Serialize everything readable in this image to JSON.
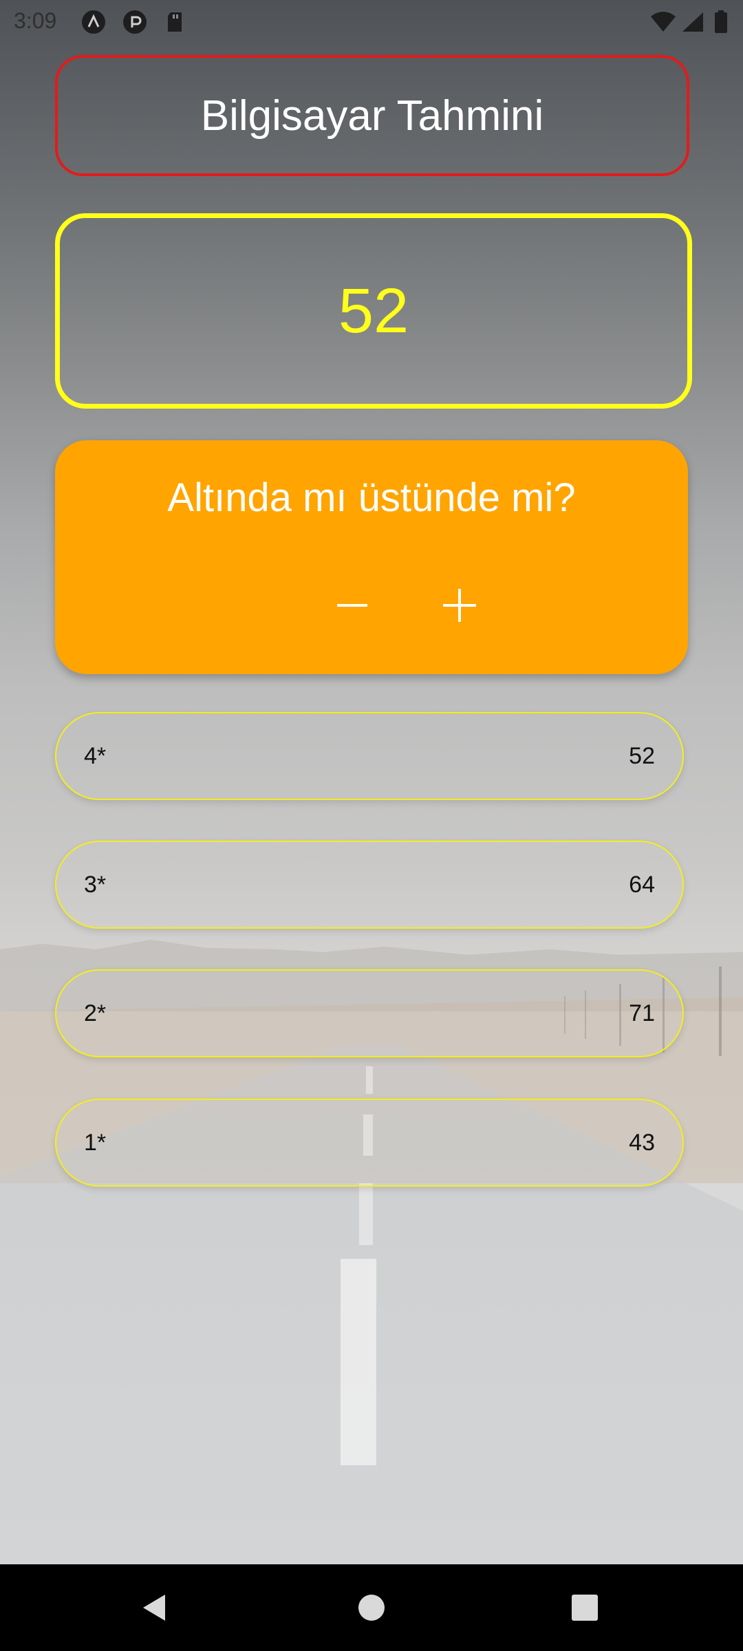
{
  "status_bar": {
    "time": "3:09",
    "icons": [
      "a-icon",
      "p-icon",
      "sd-card-icon",
      "wifi-icon",
      "signal-icon",
      "battery-icon"
    ]
  },
  "title": "Bilgisayar Tahmini",
  "guess_value": "52",
  "question": {
    "text": "Altında mı üstünde mi?",
    "minus_icon": "minus-icon",
    "plus_icon": "plus-icon"
  },
  "history": [
    {
      "label": "4*",
      "value": "52"
    },
    {
      "label": "3*",
      "value": "64"
    },
    {
      "label": "2*",
      "value": "71"
    },
    {
      "label": "1*",
      "value": "43"
    }
  ],
  "colors": {
    "title_border": "#e31b1b",
    "guess_accent": "#ffff1a",
    "question_bg": "#ffa400",
    "history_border": "#f3ef1c"
  },
  "nav": {
    "back_icon": "back-triangle-icon",
    "home_icon": "home-circle-icon",
    "recents_icon": "recents-square-icon"
  }
}
